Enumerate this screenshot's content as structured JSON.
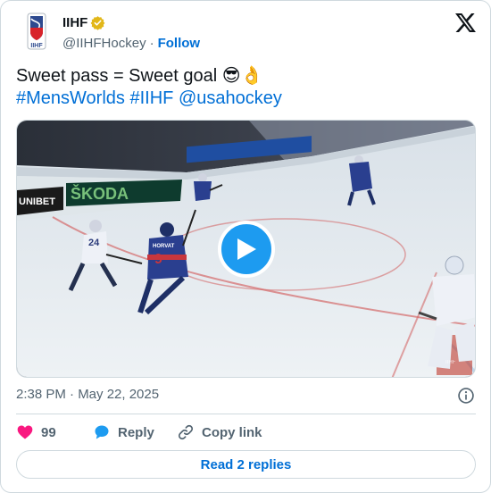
{
  "author": {
    "name": "IIHF",
    "handle": "@IIHFHockey",
    "separator": "·",
    "follow_label": "Follow",
    "verified_badge": "gold-verified-icon"
  },
  "tweet": {
    "text": "Sweet pass = Sweet goal 😎👌",
    "links": [
      "#MensWorlds",
      "#IIHF",
      "@usahockey"
    ],
    "timestamp": "2:38 PM · May 22, 2025"
  },
  "media": {
    "kind": "video",
    "board_ads": [
      "ŠKODA",
      "UNIBET"
    ],
    "player_numbers": [
      "24",
      "9"
    ],
    "player_name": "HORVAT"
  },
  "actions": {
    "like_count": "99",
    "reply_label": "Reply",
    "copy_link_label": "Copy link"
  },
  "read_replies_label": "Read 2 replies",
  "colors": {
    "link": "#006fd6",
    "play_button": "#1d9bf0",
    "like_heart": "#f91880",
    "reply_bubble": "#1d9bf0",
    "border": "#cfd9de"
  }
}
